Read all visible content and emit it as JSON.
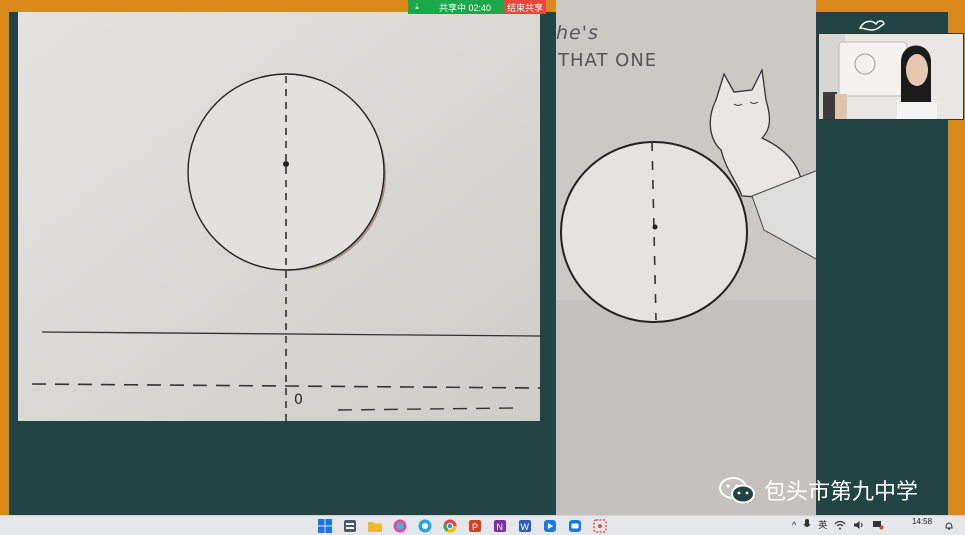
{
  "share_bar": {
    "download_symbol": "⤓",
    "status": "共享中 02:40",
    "stop_label": "结束共享"
  },
  "right_photo": {
    "line1": "he's",
    "line2": "THAT ONE"
  },
  "watermark": {
    "text": "包头市第九中学"
  },
  "left_photo": {
    "marker_label": "0"
  },
  "taskbar": {
    "apps": [
      "windows-start",
      "file-manager",
      "folder",
      "browser-colorful",
      "messenger",
      "chrome",
      "powerpoint",
      "onenote",
      "word",
      "media-player",
      "meeting-app",
      "snipping-tool"
    ],
    "tray": {
      "chevron": "^",
      "ime": "英",
      "clock_time": "14:58"
    }
  },
  "colors": {
    "frame": "#d98a1a",
    "desktop": "#224444",
    "share_green": "#1ba84a",
    "share_red": "#e8483c"
  }
}
